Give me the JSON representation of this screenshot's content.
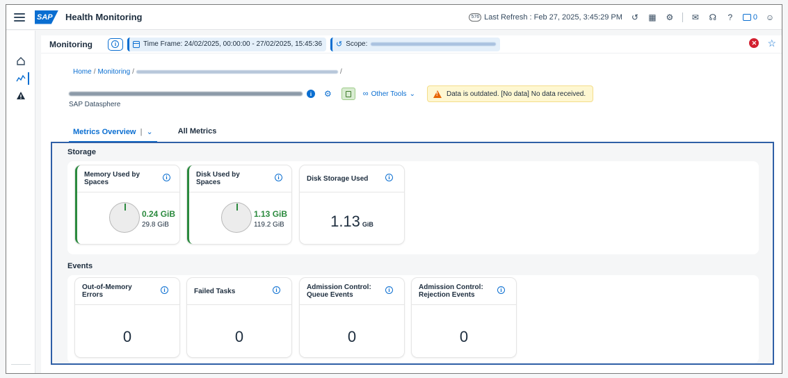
{
  "shell": {
    "title": "Health Monitoring",
    "logo_text": "SAP",
    "refresh_badge": "576",
    "last_refresh": "Last Refresh : Feb 27, 2025, 3:45:29 PM",
    "notification_count": "0"
  },
  "toolbar": {
    "title": "Monitoring",
    "time_frame": "Time Frame: 24/02/2025, 00:00:00 - 27/02/2025, 15:45:36",
    "scope_label": "Scope:"
  },
  "breadcrumb": {
    "home": "Home",
    "monitoring": "Monitoring",
    "sep": "/"
  },
  "object": {
    "subtitle": "SAP Datasphere",
    "other_tools": "Other Tools",
    "warning": "Data is outdated. [No data] No data received."
  },
  "tabs": {
    "metrics_overview": "Metrics Overview",
    "separator": "|",
    "all_metrics": "All Metrics"
  },
  "storage": {
    "title": "Storage",
    "cards": [
      {
        "title": "Memory Used by Spaces",
        "used": "0.24 GiB",
        "total": "29.8 GiB",
        "used_fraction": 0.008
      },
      {
        "title": "Disk Used by Spaces",
        "used": "1.13 GiB",
        "total": "119.2 GiB",
        "used_fraction": 0.009
      },
      {
        "title": "Disk Storage Used",
        "value": "1.13",
        "unit": "GiB"
      }
    ]
  },
  "events": {
    "title": "Events",
    "cards": [
      {
        "title": "Out-of-Memory Errors",
        "value": "0"
      },
      {
        "title": "Failed Tasks",
        "value": "0"
      },
      {
        "title": "Admission Control: Queue Events",
        "value": "0"
      },
      {
        "title": "Admission Control: Rejection Events",
        "value": "0"
      }
    ]
  },
  "colors": {
    "accent": "#0a6ed1",
    "positive": "#2b8a3e",
    "warning_bg": "#fef7d1",
    "error": "#d32030"
  }
}
